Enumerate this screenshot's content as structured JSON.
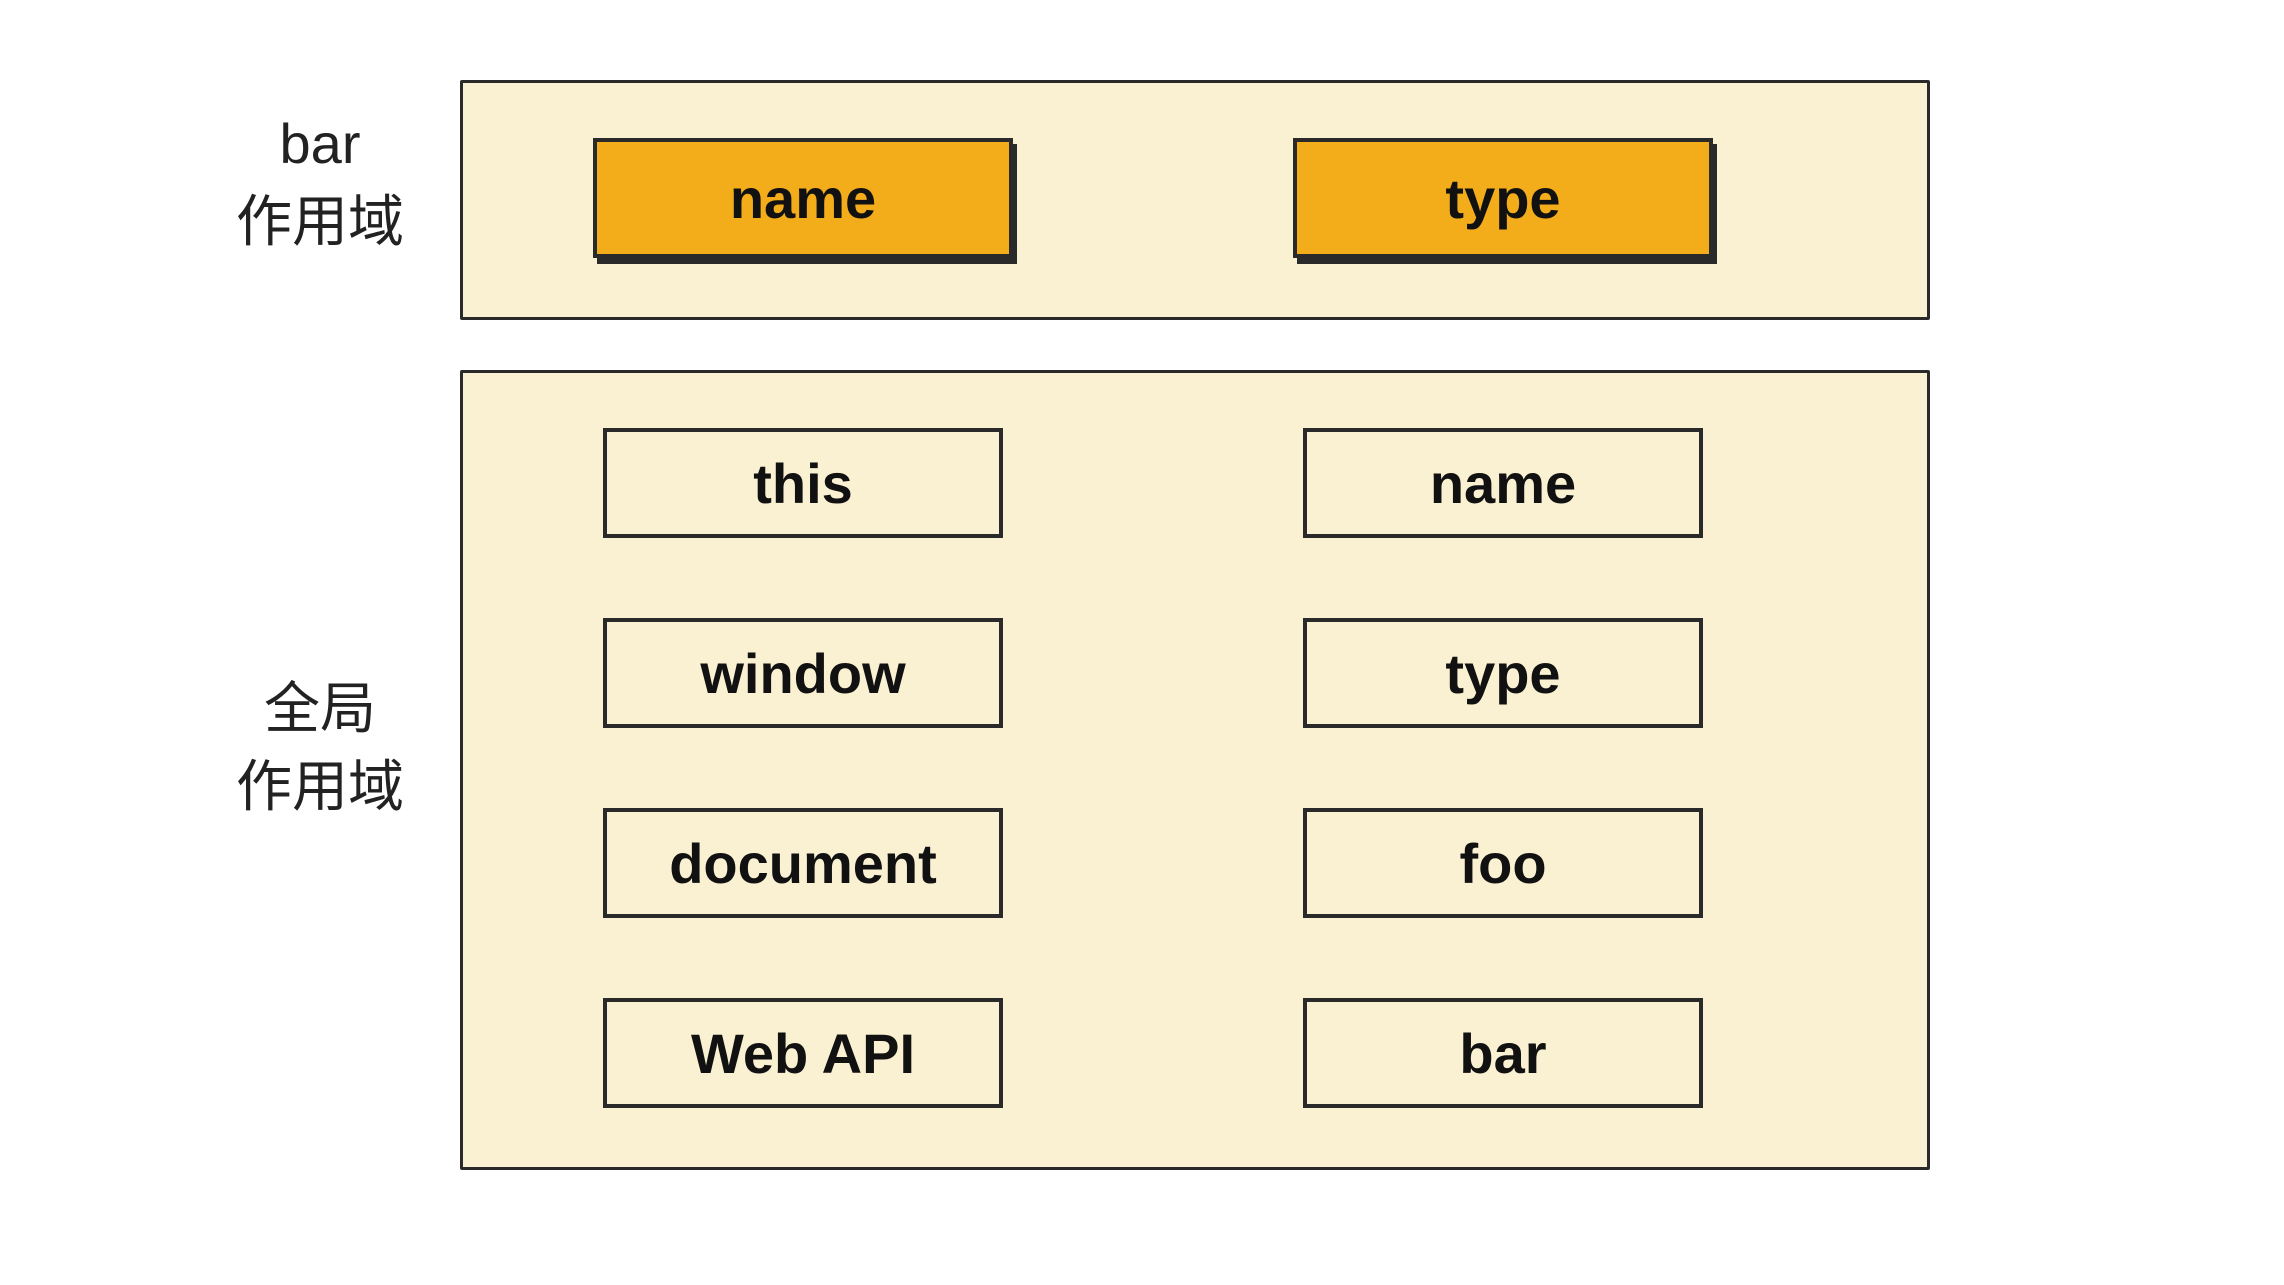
{
  "labels": {
    "bar_line1": "bar",
    "bar_line2": "作用域",
    "global_line1": "全局",
    "global_line2": "作用域"
  },
  "bar_scope": {
    "left": "name",
    "right": "type"
  },
  "global_scope": {
    "left": [
      "this",
      "window",
      "document",
      "Web API"
    ],
    "right": [
      "name",
      "type",
      "foo",
      "bar"
    ]
  }
}
